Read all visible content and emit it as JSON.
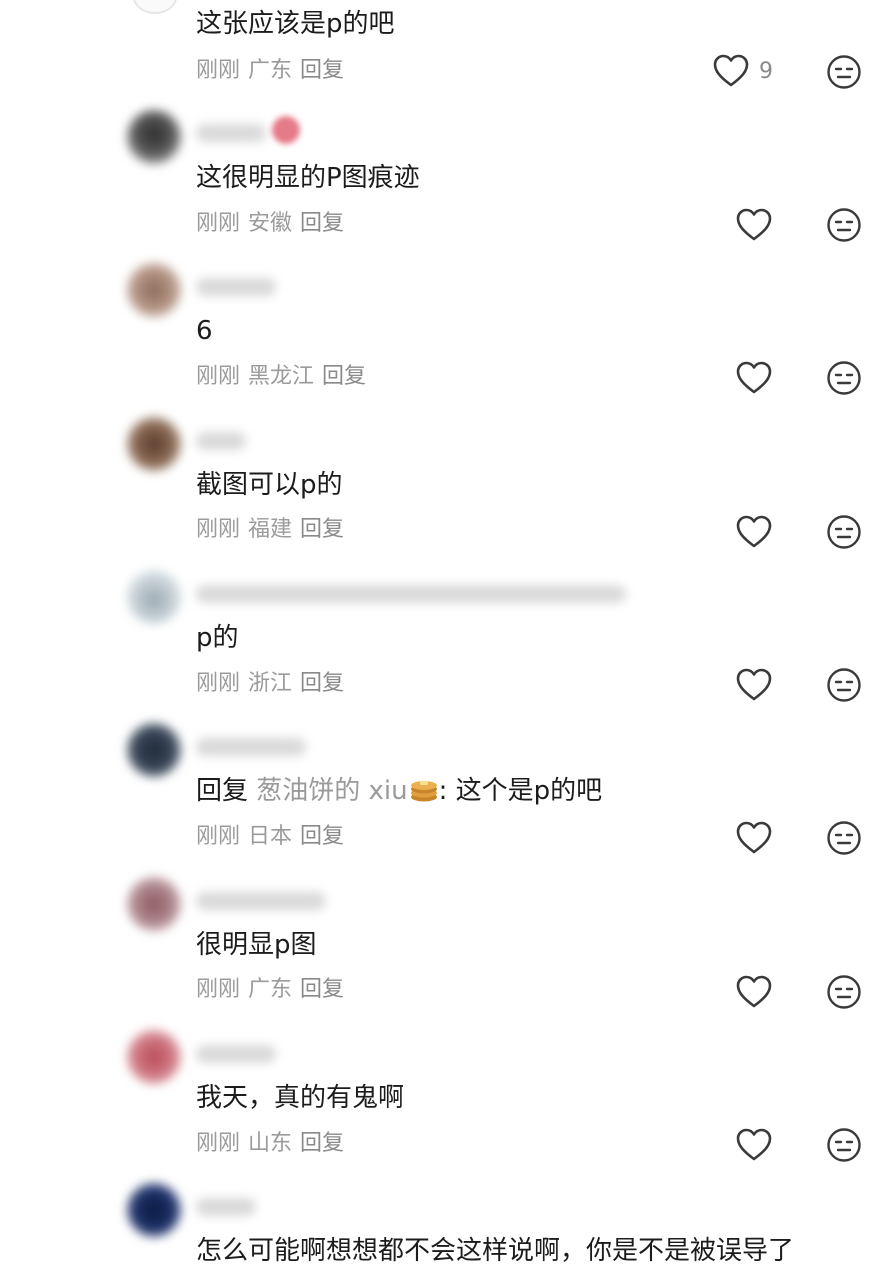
{
  "comments": [
    {
      "text": "这张应该是p的吧",
      "time": "刚刚",
      "location": "广东",
      "reply": "回复",
      "likes": "9"
    },
    {
      "text": "这很明显的P图痕迹",
      "time": "刚刚",
      "location": "安徽",
      "reply": "回复"
    },
    {
      "text": "6",
      "time": "刚刚",
      "location": "黑龙江",
      "reply": "回复"
    },
    {
      "text": "截图可以p的",
      "time": "刚刚",
      "location": "福建",
      "reply": "回复"
    },
    {
      "text": "p的",
      "time": "刚刚",
      "location": "浙江",
      "reply": "回复"
    },
    {
      "reply_prefix": "回复",
      "mention": "葱油饼的 xiu",
      "text_after": ": 这个是p的吧",
      "time": "刚刚",
      "location": "日本",
      "reply": "回复"
    },
    {
      "text": "很明显p图",
      "time": "刚刚",
      "location": "广东",
      "reply": "回复"
    },
    {
      "text": "我天，真的有鬼啊",
      "time": "刚刚",
      "location": "山东",
      "reply": "回复"
    },
    {
      "text": "怎么可能啊想想都不会这样说啊，你是不是被误导了"
    }
  ],
  "icons": {
    "like": "heart-outline-icon",
    "dislike": "neutral-face-icon",
    "emoji": "pancake-emoji-icon"
  },
  "colors": {
    "text": "#1c1c1c",
    "meta": "#9b9b9b",
    "icon": "#3a3a3a"
  }
}
